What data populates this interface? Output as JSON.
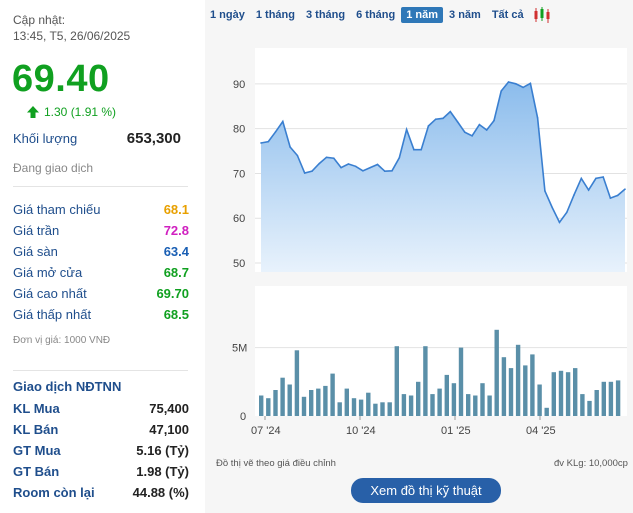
{
  "header": {
    "updated_label": "Cập nhật:",
    "updated_time": "13:45, T5, 26/06/2025"
  },
  "quote": {
    "price": "69.40",
    "change": "1.30 (1.91 %)",
    "volume_label": "Khối lượng",
    "volume_value": "653,300",
    "status": "Đang giao dịch"
  },
  "price_rows": [
    {
      "label": "Giá tham chiếu",
      "value": "68.1",
      "color": "#e8a000"
    },
    {
      "label": "Giá trần",
      "value": "72.8",
      "color": "#d020c0"
    },
    {
      "label": "Giá sàn",
      "value": "63.4",
      "color": "#1a5fb4"
    },
    {
      "label": "Giá mở cửa",
      "value": "68.7",
      "color": "#10a020"
    },
    {
      "label": "Giá cao nhất",
      "value": "69.70",
      "color": "#10a020"
    },
    {
      "label": "Giá thấp nhất",
      "value": "68.5",
      "color": "#10a020"
    }
  ],
  "unit_note": "Đơn vị giá: 1000 VNĐ",
  "foreign": {
    "title": "Giao dịch NĐTNN",
    "rows": [
      {
        "label": "KL Mua",
        "value": "75,400"
      },
      {
        "label": "KL Bán",
        "value": "47,100"
      },
      {
        "label": "GT Mua",
        "value": "5.16 (Tỷ)"
      },
      {
        "label": "GT Bán",
        "value": "1.98 (Tỷ)"
      },
      {
        "label": "Room còn lại",
        "value": "44.88 (%)"
      }
    ]
  },
  "tabs": [
    "1 ngày",
    "1 tháng",
    "3 tháng",
    "6 tháng",
    "1 năm",
    "3 năm",
    "Tất cả"
  ],
  "active_tab": "1 năm",
  "colors": {
    "up": "#10a020",
    "line": "#3a7fd0",
    "area_top": "#8bbcec",
    "area_bottom": "#e8f2fc",
    "volume_bar": "#5a8fa8",
    "button": "#2860a8"
  },
  "chart_data": [
    {
      "type": "area",
      "y_ticks": [
        "90",
        "80",
        "70",
        "60",
        "50"
      ],
      "ylim": [
        48,
        98
      ],
      "x_tick_labels": [
        "07 '24",
        "10 '24",
        "01 '25",
        "04 '25"
      ],
      "grid": true,
      "values": [
        76.8,
        77.1,
        79.3,
        81.6,
        75.9,
        74.0,
        70.1,
        70.5,
        72.2,
        73.6,
        73.4,
        71.3,
        72.1,
        71.6,
        70.6,
        71.3,
        72.0,
        70.5,
        70.6,
        73.5,
        79.8,
        75.3,
        75.3,
        80.6,
        82.1,
        82.3,
        83.8,
        81.5,
        79.2,
        78.4,
        80.9,
        79.7,
        81.8,
        88.4,
        90.4,
        90.0,
        89.2,
        90.1,
        82.4,
        66.1,
        62.4,
        59.1,
        61.3,
        65.2,
        68.9,
        66.3,
        68.9,
        69.2,
        64.5,
        65.1,
        66.5
      ]
    },
    {
      "type": "bar",
      "y_ticks": [
        "5M",
        "0"
      ],
      "ylim": [
        0,
        9.5
      ],
      "values": [
        1.5,
        1.3,
        1.9,
        2.8,
        2.3,
        4.8,
        1.4,
        1.9,
        2.0,
        2.2,
        3.1,
        1.0,
        2.0,
        1.3,
        1.2,
        1.7,
        0.9,
        1.0,
        1.0,
        5.1,
        1.6,
        1.5,
        2.5,
        5.1,
        1.6,
        2.0,
        3.0,
        2.4,
        5.0,
        1.6,
        1.5,
        2.4,
        1.5,
        6.3,
        4.3,
        3.5,
        5.2,
        3.7,
        4.5,
        2.3,
        0.6,
        3.2,
        3.3,
        3.2,
        3.5,
        1.6,
        1.1,
        1.9,
        2.5,
        2.5,
        2.6
      ]
    }
  ],
  "chart_note_left": "Đồ thị vẽ theo giá điều chỉnh",
  "chart_note_right": "đv KLg: 10,000cp",
  "tech_button_label": "Xem đồ thị kỹ thuật"
}
